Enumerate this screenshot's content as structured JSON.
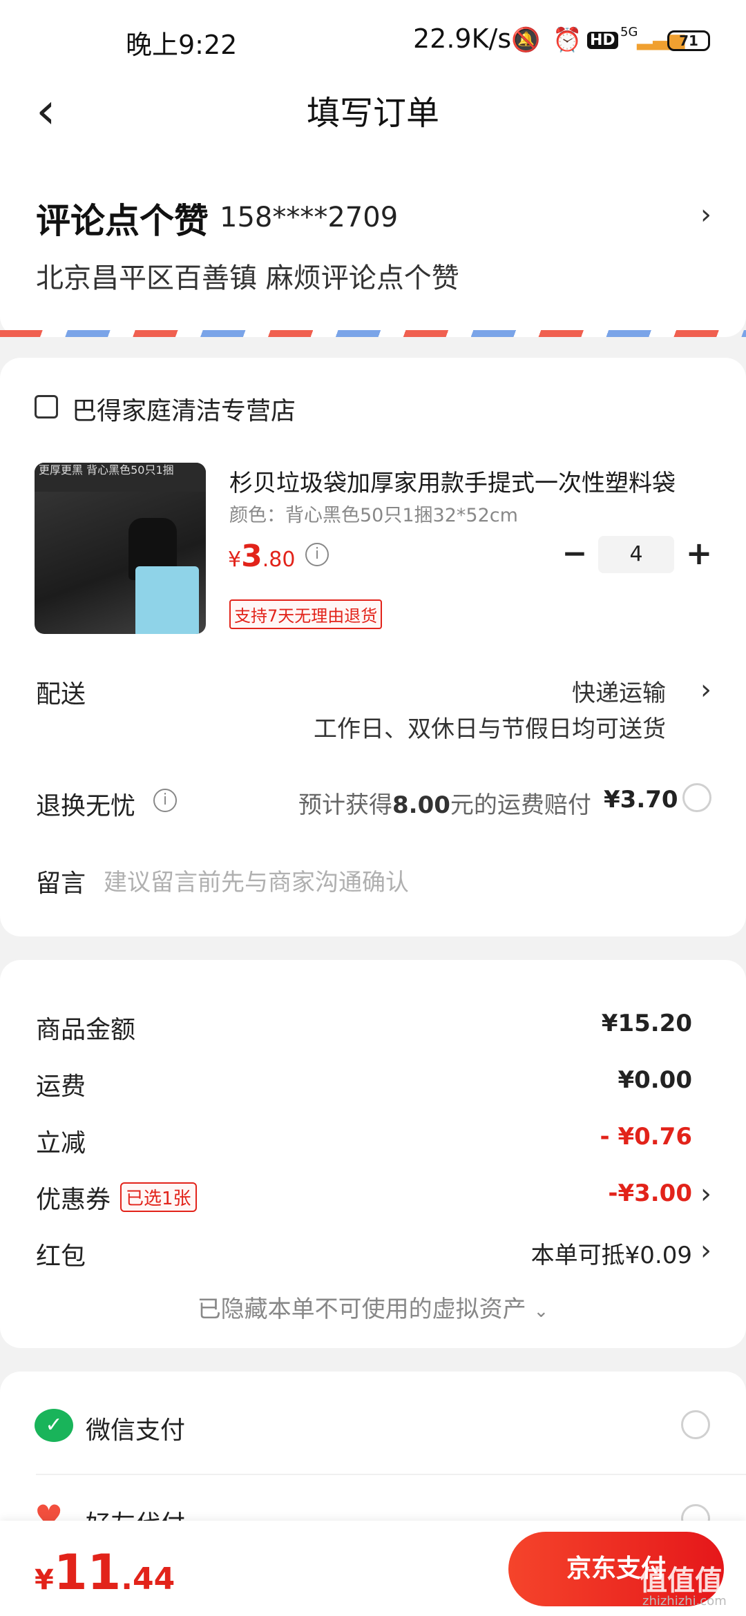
{
  "status_bar": {
    "time": "晚上9:22",
    "speed": "22.9K/s",
    "battery": "71",
    "network": "5G"
  },
  "header": {
    "back_icon": "chevron-left-icon",
    "title": "填写订单"
  },
  "address": {
    "name": "评论点个赞",
    "phone": "158****2709",
    "detail": "北京昌平区百善镇 麻烦评论点个赞"
  },
  "store": {
    "name": "巴得家庭清洁专营店",
    "icon": "store-icon"
  },
  "product": {
    "image_tag": "更厚更黑 背心黑色50只1捆",
    "title": "杉贝垃圾袋加厚家用款手提式一次性塑料袋",
    "spec": "颜色：背心黑色50只1捆32*52cm",
    "price_currency": "¥",
    "price_int": "3",
    "price_dec": ".80",
    "quantity": "4",
    "minus": "−",
    "plus": "+",
    "return_badge": "支持7天无理由退货"
  },
  "delivery": {
    "label": "配送",
    "method": "快递运输",
    "note": "工作日、双休日与节假日均可送货"
  },
  "return_worry": {
    "label": "退换无忧",
    "desc_prefix": "预计获得",
    "desc_amount": "8.00",
    "desc_suffix": "元的运费赔付",
    "price": "¥3.70"
  },
  "message": {
    "label": "留言",
    "placeholder": "建议留言前先与商家沟通确认"
  },
  "summary": {
    "goods_label": "商品金额",
    "goods_value": "¥15.20",
    "shipping_label": "运费",
    "shipping_value": "¥0.00",
    "discount_label": "立减",
    "discount_value": "- ¥0.76",
    "coupon_label": "优惠券",
    "coupon_badge": "已选1张",
    "coupon_value": "-¥3.00",
    "redpacket_label": "红包",
    "redpacket_value": "本单可抵¥0.09",
    "hidden_assets": "已隐藏本单不可使用的虚拟资产"
  },
  "payment": {
    "wechat_label": "微信支付",
    "friend_label": "好友代付"
  },
  "bottom": {
    "total_currency": "¥",
    "total_int": "11",
    "total_dec": ".44",
    "pay_button": "京东支付",
    "watermark": "值值值",
    "watermark_sub": "zhizhizhi.com"
  },
  "colors": {
    "accent_red": "#e2231a",
    "wechat_green": "#19b45a"
  }
}
